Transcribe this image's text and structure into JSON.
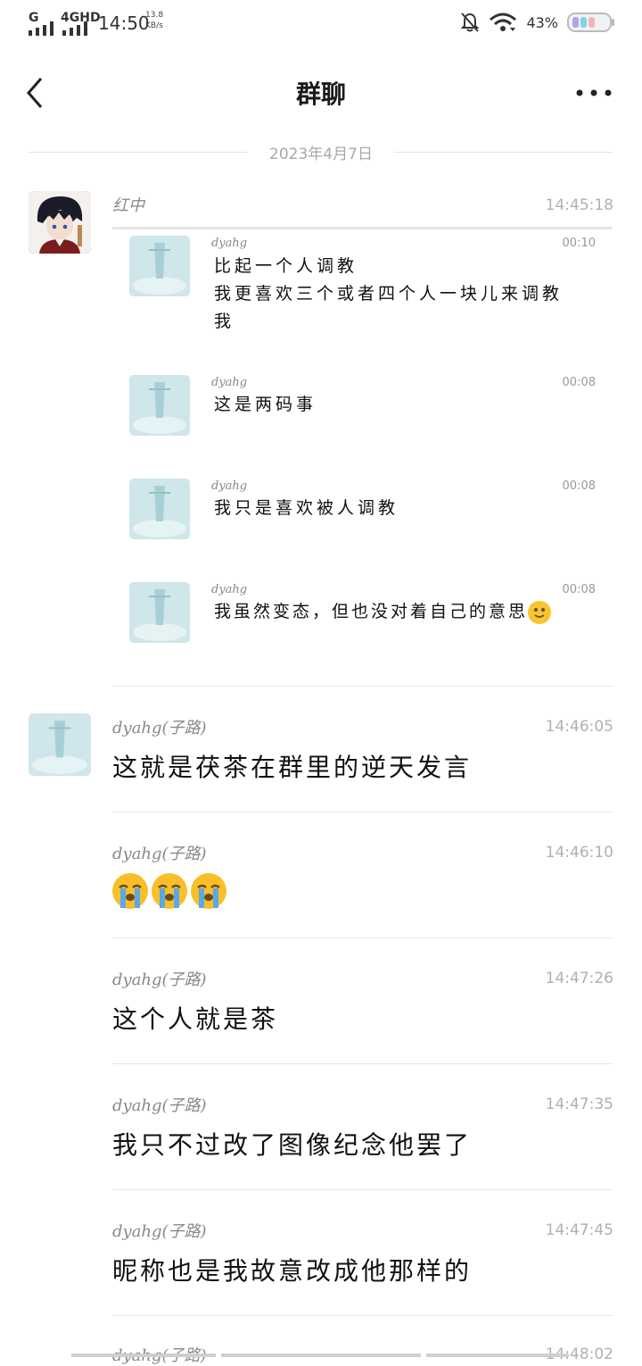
{
  "status_bar": {
    "sig1_label": "G",
    "sig2_label": "4GHD",
    "time": "14:50",
    "speed_value": "13.8",
    "speed_unit": "KB/s",
    "battery_pct": "43%"
  },
  "header": {
    "title": "群聊"
  },
  "date_divider": "2023年4月7日",
  "messages": [
    {
      "sender": "红中",
      "time": "14:45:18",
      "forwarded": [
        {
          "sender": "dyahg",
          "time": "00:10",
          "lines": [
            "比起一个人调教",
            "我更喜欢三个或者四个人一块儿来调教",
            "我"
          ]
        },
        {
          "sender": "dyahg",
          "time": "00:08",
          "lines": [
            "这是两码事"
          ]
        },
        {
          "sender": "dyahg",
          "time": "00:08",
          "lines": [
            "我只是喜欢被人调教"
          ]
        },
        {
          "sender": "dyahg",
          "time": "00:08",
          "lines": [
            "我虽然变态，但也没对着自己的意思"
          ]
        }
      ]
    },
    {
      "sender": "dyahg(子路)",
      "time": "14:46:05",
      "text": "这就是茯茶在群里的逆天发言"
    },
    {
      "sender": "dyahg(子路)",
      "time": "14:46:10",
      "text": ""
    },
    {
      "sender": "dyahg(子路)",
      "time": "14:47:26",
      "text": "这个人就是茶"
    },
    {
      "sender": "dyahg(子路)",
      "time": "14:47:35",
      "text": "我只不过改了图像纪念他罢了"
    },
    {
      "sender": "dyahg(子路)",
      "time": "14:47:45",
      "text": "昵称也是我故意改成他那样的"
    },
    {
      "sender": "dyahg(子路)",
      "time": "14:48:02",
      "text": ""
    }
  ]
}
